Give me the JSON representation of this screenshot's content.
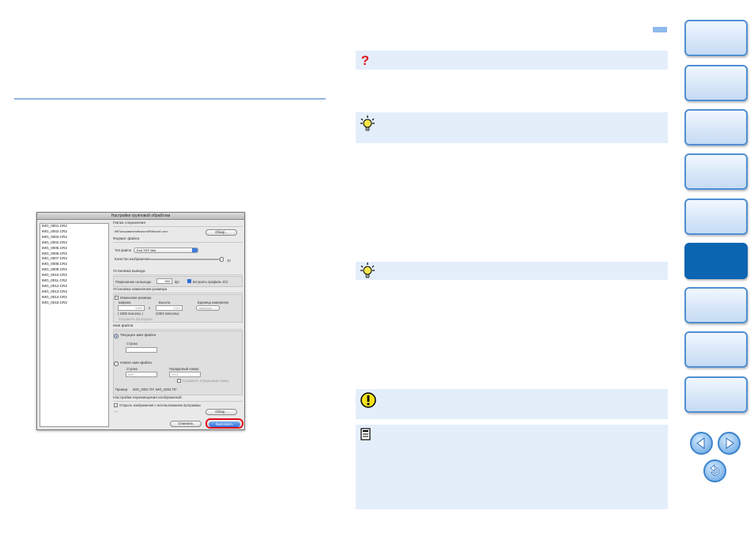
{
  "dialog": {
    "title": "Настройки групповой обработки",
    "files": [
      "IMG_0001.CR2",
      "IMG_0002.CR2",
      "IMG_0003.CR2",
      "IMG_0004.CR2",
      "IMG_0005.CR2",
      "IMG_0006.CR2",
      "IMG_0007.CR2",
      "IMG_0008.CR2",
      "IMG_0009.CR2",
      "IMG_0010.CR2",
      "IMG_0011.CR2",
      "IMG_0012.CR2",
      "IMG_0013.CR2",
      "IMG_0014.CR2",
      "IMG_0015.CR2"
    ],
    "save_folder": {
      "heading": "Папка сохранения",
      "path": "¥¥Пользователи¥canon¥Рабочий стол",
      "browse": "Обзор..."
    },
    "file_format": {
      "heading": "Формат файла",
      "type_label": "Тип файла",
      "type_value": "Exif-TIFF 8bit",
      "quality_label": "Качество изображения",
      "quality_value": "10"
    },
    "output": {
      "heading": "Установка вывода",
      "resolution_label": "Разрешение на выходе",
      "resolution_value": "350",
      "resolution_unit": "dpi",
      "icc_label": "Встроить профиль ICC"
    },
    "resize": {
      "heading": "Установка изменения размера",
      "checkbox_label": "Изменение размера",
      "width_label": "Ширина",
      "height_label": "Высота",
      "unit_label": "Единица измерения",
      "width_value": "3456",
      "height_value": "2304",
      "x_sign": "x",
      "unit_value": "пикселы",
      "width_px": "( 3456 пикселы )",
      "height_px": "(2304 пикселы)",
      "keep_ratio": "Сохранять пропорции"
    },
    "filename": {
      "heading": "Имя файла",
      "current_label": "Текущее имя файла",
      "string_label": "Строка",
      "new_label": "Новое имя файла",
      "new_string_label": "Строка",
      "serial_label": "Порядковый номер",
      "new_string_value": "IMP_",
      "serial_value": "0001",
      "keep_serial": "Сохранить порядковый номер",
      "example_label": "Пример:",
      "example_value": "IMG_0002.TIF, IMG_0004.TIF"
    },
    "transfer": {
      "heading": "Настройки перемещения изображений",
      "open_label": "Открыть изображения с использованием программы",
      "dash": "---",
      "browse": "Обзор..."
    },
    "cancel": "Отменить",
    "execute": "Выполнить"
  },
  "icons": {
    "question": "question-icon",
    "tip": "lightbulb-icon",
    "caution": "caution-icon",
    "note": "memo-icon"
  },
  "colors": {
    "accent": "#0c65b0",
    "box_bg": "#e4eefb",
    "highlight": "#e0101c"
  }
}
